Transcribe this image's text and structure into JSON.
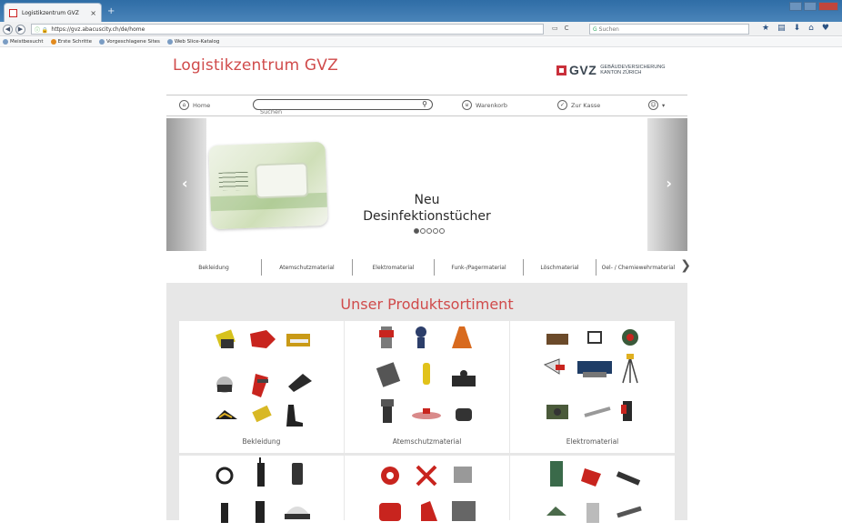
{
  "browser": {
    "tab_title": "Logistikzentrum GVZ",
    "tab_close": "×",
    "new_tab": "+",
    "url": "https://gvz.abacuscity.ch/de/home",
    "search_placeholder": "Suchen",
    "bookmarks": [
      "Meistbesucht",
      "Erste Schritte",
      "Vorgeschlagene Sites",
      "Web Slice-Katalog"
    ]
  },
  "header": {
    "site_title": "Logistikzentrum GVZ",
    "logo_text": "GVZ",
    "logo_sub1": "GEBÄUDEVERSICHERUNG",
    "logo_sub2": "KANTON ZÜRICH"
  },
  "nav": {
    "home": "Home",
    "search_placeholder": "Suchen",
    "cart": "Warenkorb",
    "checkout": "Zur Kasse",
    "account_arrow": "▾"
  },
  "hero": {
    "line1": "Neu",
    "line2": "Desinfektionstücher",
    "prev": "‹",
    "next": "›"
  },
  "categories": [
    "Bekleidung",
    "Atemschutzmaterial",
    "Elektromaterial",
    "Funk-/Pagermaterial",
    "Löschmaterial",
    "Oel- / Chemiewehrmaterial"
  ],
  "categories_next": "❯",
  "products": {
    "heading": "Unser Produktsortiment",
    "cards": [
      {
        "label": "Bekleidung"
      },
      {
        "label": "Atemschutzmaterial"
      },
      {
        "label": "Elektromaterial"
      },
      {
        "label": ""
      },
      {
        "label": ""
      },
      {
        "label": ""
      }
    ]
  },
  "colors": {
    "brand_red": "#d04b4b",
    "gvz_red": "#c9303b",
    "panel_gray": "#e7e7e7"
  }
}
